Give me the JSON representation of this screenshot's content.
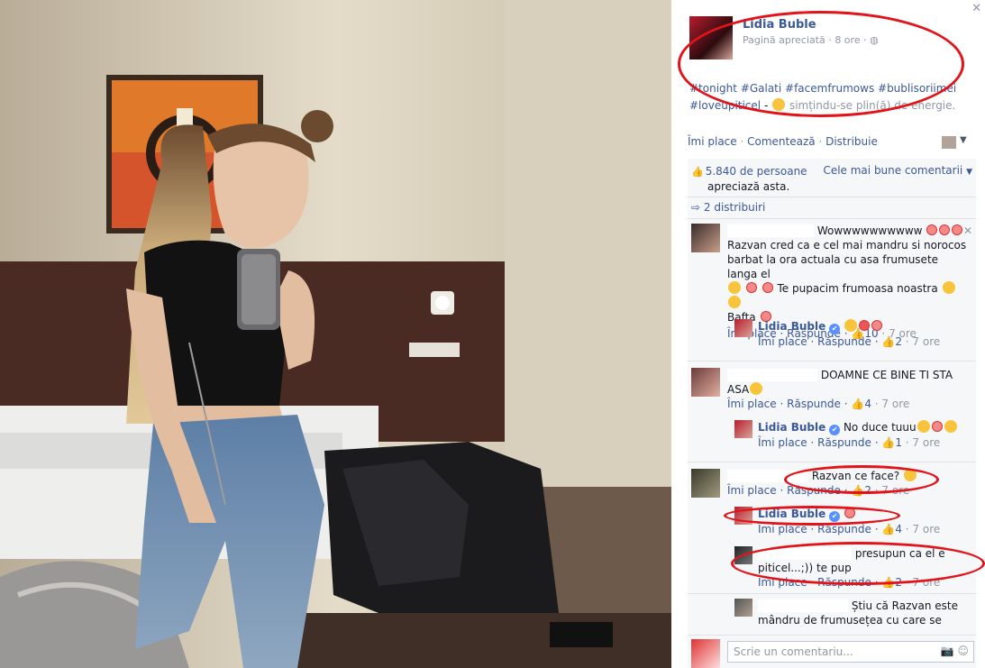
{
  "post": {
    "page_name": "Lidia Buble",
    "meta_liked": "Pagină apreciată",
    "meta_time": "8 ore",
    "globe_icon": "globe-icon",
    "hashtags": "#tonight #Galati #facemfrumows #bublisoriimei #loveupiticel",
    "feeling": "simțindu-se plin(ă) de energie.",
    "action_like": "Îmi place",
    "action_comment": "Comentează",
    "action_share": "Distribuie",
    "likes_count": "5.840 de persoane",
    "likes_suffix": "apreciază asta.",
    "sort_label": "Cele mai bune comentarii",
    "shares": "2 distribuiri"
  },
  "comments": [
    {
      "text1": "Wowwwwwwwwww",
      "text2": "Razvan cred ca e cel mai mandru si norocos barbat la ora actuala cu asa frumusete langa el",
      "text3": "Te pupacim frumoasa noastra",
      "text4": "Bafta",
      "like": "Îmi place",
      "reply": "Răspunde",
      "count": "10",
      "time": "7 ore"
    },
    {
      "author": "Lidia Buble",
      "like": "Îmi place",
      "reply": "Răspunde",
      "count": "2",
      "time": "7 ore"
    },
    {
      "text1": "DOAMNE CE BINE TI STA",
      "text2": "ASA",
      "like": "Îmi place",
      "reply": "Răspunde",
      "count": "4",
      "time": "7 ore"
    },
    {
      "author": "Lidia Buble",
      "text": "No duce tuuu",
      "like": "Îmi place",
      "reply": "Răspunde",
      "count": "1",
      "time": "7 ore"
    },
    {
      "text": "Razvan ce face?",
      "like": "Îmi place",
      "reply": "Răspunde",
      "count": "2",
      "time": "7 ore"
    },
    {
      "author": "Lidia Buble",
      "like": "Îmi place",
      "reply": "Răspunde",
      "count": "4",
      "time": "7 ore"
    },
    {
      "text1": "presupun ca el e",
      "text2": "piticel...;)) te pup",
      "like": "Îmi place",
      "reply": "Răspunde",
      "count": "2",
      "time": "7 ore"
    },
    {
      "text1": "Știu că Razvan este",
      "text2": "mândru de frumusețea cu care se"
    }
  ],
  "composer": {
    "placeholder": "Scrie un comentariu...",
    "camera_icon": "camera-icon",
    "emoji_icon": "emoji-icon"
  }
}
